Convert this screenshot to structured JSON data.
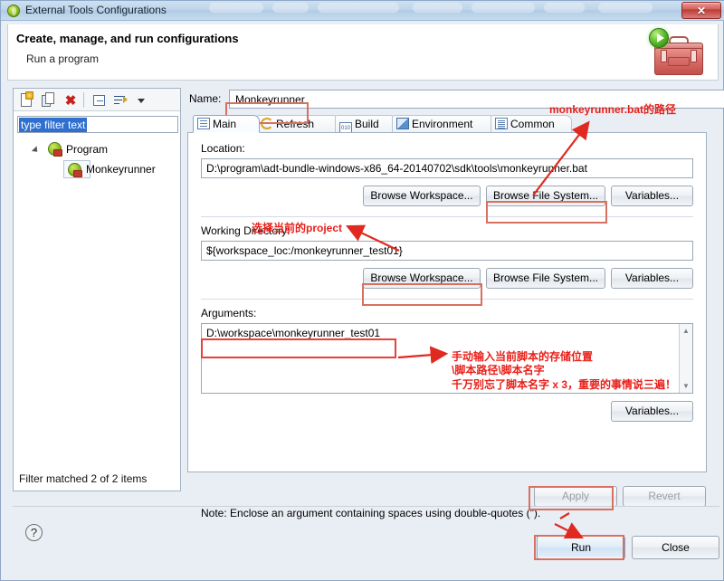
{
  "window": {
    "title": "External Tools Configurations",
    "title_icon": "eclipse-globe-icon",
    "close_label": "✕"
  },
  "header": {
    "title": "Create, manage, and run configurations",
    "subtitle": "Run a program",
    "graphic": "toolbox-with-play-badge-icon"
  },
  "left_panel": {
    "toolbar": [
      {
        "name": "new-configuration-button",
        "icon": "new-document-icon"
      },
      {
        "name": "duplicate-configuration-button",
        "icon": "copy-icon"
      },
      {
        "name": "delete-configuration-button",
        "icon": "red-x-icon"
      },
      {
        "name": "collapse-all-button",
        "icon": "collapse-all-icon"
      },
      {
        "name": "filter-button",
        "icon": "sort-filter-icon"
      },
      {
        "name": "view-menu-button",
        "icon": "chevron-down-icon"
      }
    ],
    "filter": {
      "value": "type filter text",
      "placeholder": "type filter text"
    },
    "tree": [
      {
        "label": "Program",
        "level": 0,
        "expanded": true,
        "selected": false
      },
      {
        "label": "Monkeyrunner",
        "level": 1,
        "expanded": false,
        "selected": true
      }
    ],
    "status": "Filter matched 2 of 2 items"
  },
  "main": {
    "name_label": "Name:",
    "name_value": "Monkeyrunner",
    "tabs": [
      {
        "label": "Main",
        "icon": "main-page-icon",
        "active": true
      },
      {
        "label": "Refresh",
        "icon": "refresh-icon",
        "active": false
      },
      {
        "label": "Build",
        "icon": "build-binary-icon",
        "active": false
      },
      {
        "label": "Environment",
        "icon": "environment-icon",
        "active": false
      },
      {
        "label": "Common",
        "icon": "common-list-icon",
        "active": false
      }
    ],
    "location": {
      "label": "Location:",
      "value": "D:\\program\\adt-bundle-windows-x86_64-20140702\\sdk\\tools\\monkeyrunner.bat",
      "buttons": [
        {
          "label": "Browse Workspace...",
          "highlighted": false
        },
        {
          "label": "Browse File System...",
          "highlighted": true
        },
        {
          "label": "Variables...",
          "highlighted": false
        }
      ]
    },
    "working_directory": {
      "label": "Working Directory:",
      "value": "${workspace_loc:/monkeyrunner_test01}",
      "buttons": [
        {
          "label": "Browse Workspace...",
          "highlighted": true
        },
        {
          "label": "Browse File System...",
          "highlighted": false
        },
        {
          "label": "Variables...",
          "highlighted": false
        }
      ]
    },
    "arguments": {
      "label": "Arguments:",
      "value": "D:\\workspace\\monkeyrunner_test01",
      "buttons": [
        {
          "label": "Variables...",
          "highlighted": false
        }
      ],
      "scrollbar": {
        "up_arrow": "▲",
        "down_arrow": "▼"
      }
    },
    "note": "Note: Enclose an argument containing spaces using double-quotes (\")."
  },
  "footer": {
    "apply_label": "Apply",
    "apply_enabled": false,
    "revert_label": "Revert",
    "revert_enabled": false,
    "run_label": "Run",
    "close_label": "Close",
    "help_icon": "?"
  },
  "annotations": {
    "colors": {
      "red": "#e8201a",
      "box": "#e8413a",
      "soft_box": "#d9705f"
    },
    "labels": {
      "location_path": "monkeyrunner.bat的路径",
      "select_project": "选择当前的project",
      "arguments_line1": "手动输入当前脚本的存储位置",
      "arguments_line2": "\\脚本路径\\脚本名字",
      "arguments_line3": "千万别忘了脚本名字 x 3，重要的事情说三遍！"
    }
  }
}
